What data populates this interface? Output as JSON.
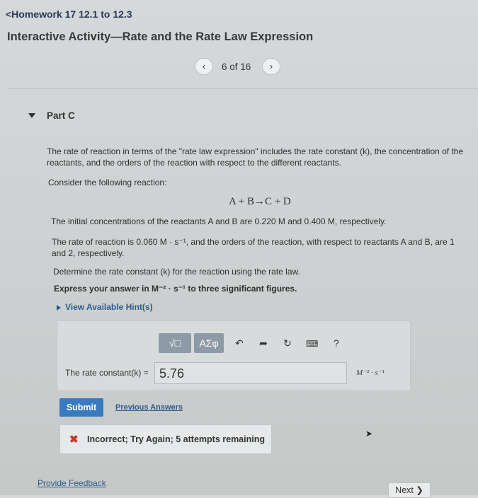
{
  "header": {
    "back_label": "<Homework 17 12.1 to 12.3",
    "title": "Interactive Activity—Rate and the Rate Law Expression",
    "prev_icon": "chevron-left-icon",
    "next_icon": "chevron-right-icon",
    "counter": "6 of 16"
  },
  "part": {
    "label": "Part C"
  },
  "problem": {
    "intro_line1": "The rate of reaction in terms of the \"rate law expression\" includes the rate constant (k), the concentration of the",
    "intro_line2": "reactants, and the orders of the reaction with respect to the different reactants.",
    "consider": "Consider the following reaction:",
    "reaction": "A + B→C + D",
    "concentrations": "The initial concentrations of the reactants A and B are 0.220 M and 0.400 M, respectively.",
    "rate_line1": "The rate of reaction is 0.060 M · s⁻¹, and the orders of the reaction, with respect to reactants A and B, are 1",
    "rate_line2": "and 2, respectively.",
    "determine": "Determine the rate constant (k) for the reaction using the rate law.",
    "express": "Express your answer in M⁻² · s⁻¹ to three significant figures."
  },
  "hints": {
    "label": "View Available Hint(s)"
  },
  "toolbar": {
    "template_label": "√□",
    "symbols_label": "ΑΣφ",
    "undo_icon": "undo-icon",
    "redo_icon": "redo-icon",
    "reset_icon": "reset-icon",
    "keyboard_icon": "keyboard-icon",
    "help_label": "?"
  },
  "answer": {
    "label": "The rate constant(k) =",
    "value": "5.76",
    "unit": "M⁻² · s⁻¹"
  },
  "actions": {
    "submit_label": "Submit",
    "previous_answers_label": "Previous Answers"
  },
  "feedback": {
    "icon": "x-icon",
    "message": "Incorrect; Try Again; 5 attempts remaining"
  },
  "footer": {
    "provide_feedback": "Provide Feedback",
    "next_label": "Next ❯"
  },
  "colors": {
    "link": "#2c5a8c",
    "submit_bg": "#3a7bc0",
    "error": "#c0392b",
    "toolbar_button": "#8e9aa6"
  }
}
